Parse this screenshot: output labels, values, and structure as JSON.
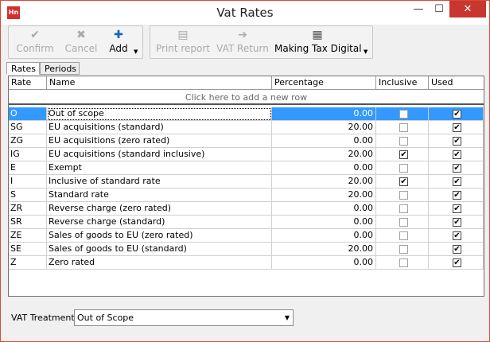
{
  "window": {
    "title": "Vat Rates",
    "app_icon": "Hn",
    "minimize": "—",
    "maximize": "☐",
    "close": "✕"
  },
  "toolbar": {
    "confirm": {
      "label": "Confirm",
      "icon": "✔"
    },
    "cancel": {
      "label": "Cancel",
      "icon": "✖"
    },
    "add": {
      "label": "Add",
      "icon": "✚"
    },
    "print_report": {
      "label": "Print report",
      "icon": "▤"
    },
    "vat_return": {
      "label": "VAT Return",
      "icon": "➔"
    },
    "mtd": {
      "label": "Making Tax Digital",
      "icon": "▦"
    },
    "dropdown": "▼"
  },
  "tabs": [
    {
      "label": "Rates",
      "active": true
    },
    {
      "label": "Periods",
      "active": false
    }
  ],
  "grid": {
    "headers": [
      "Rate",
      "Name",
      "Percentage",
      "Inclusive",
      "Used"
    ],
    "new_row_text": "Click here to add a new row",
    "check_glyph": "✔",
    "rows": [
      {
        "rate": "O",
        "name": "Out of scope",
        "percentage": "0.00",
        "inclusive": false,
        "used": true
      },
      {
        "rate": "SG",
        "name": "EU acquisitions (standard)",
        "percentage": "20.00",
        "inclusive": false,
        "used": true
      },
      {
        "rate": "ZG",
        "name": "EU acquisitions (zero rated)",
        "percentage": "0.00",
        "inclusive": false,
        "used": true
      },
      {
        "rate": "IG",
        "name": "EU acquisitions (standard inclusive)",
        "percentage": "20.00",
        "inclusive": true,
        "used": true
      },
      {
        "rate": "E",
        "name": "Exempt",
        "percentage": "0.00",
        "inclusive": false,
        "used": true
      },
      {
        "rate": "I",
        "name": "Inclusive of standard rate",
        "percentage": "20.00",
        "inclusive": true,
        "used": true
      },
      {
        "rate": "S",
        "name": "Standard rate",
        "percentage": "20.00",
        "inclusive": false,
        "used": true
      },
      {
        "rate": "ZR",
        "name": "Reverse charge (zero rated)",
        "percentage": "0.00",
        "inclusive": false,
        "used": true
      },
      {
        "rate": "SR",
        "name": "Reverse charge (standard)",
        "percentage": "0.00",
        "inclusive": false,
        "used": true
      },
      {
        "rate": "ZE",
        "name": "Sales of goods to EU (zero rated)",
        "percentage": "0.00",
        "inclusive": false,
        "used": true
      },
      {
        "rate": "SE",
        "name": "Sales of goods to EU (standard)",
        "percentage": "20.00",
        "inclusive": false,
        "used": true
      },
      {
        "rate": "Z",
        "name": "Zero rated",
        "percentage": "0.00",
        "inclusive": false,
        "used": true
      }
    ]
  },
  "footer": {
    "vat_treatment_label": "VAT Treatment:",
    "vat_treatment_value": "Out of Scope",
    "dropdown_arrow": "▼"
  },
  "colors": {
    "selection": "#3399ff",
    "close_button": "#c7372f",
    "add_icon": "#1565c0",
    "app_icon": "#d32f2f"
  }
}
